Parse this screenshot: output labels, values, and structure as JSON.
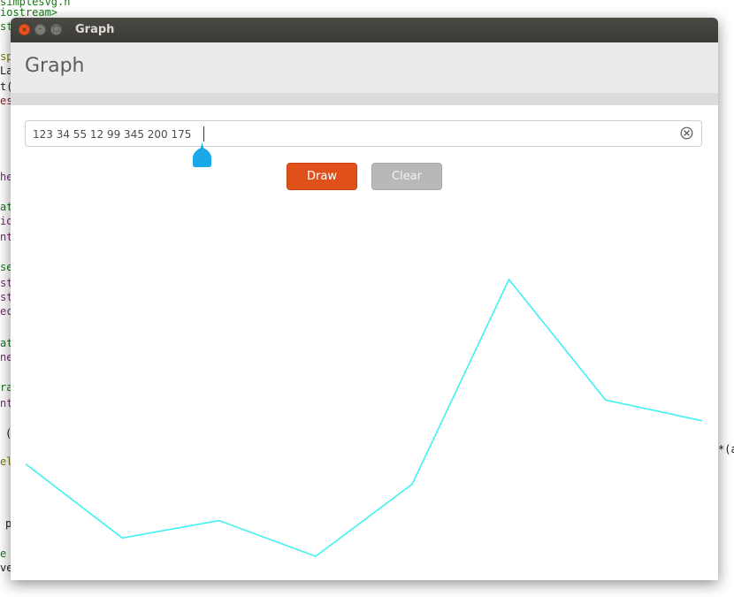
{
  "background": {
    "code_lines": [
      {
        "text": "simplesvg.h",
        "class": "green"
      },
      {
        "text": "iostream>",
        "class": "green"
      },
      {
        "text": "st",
        "class": "green"
      },
      {
        "text": "sp",
        "class": "olive"
      },
      {
        "text": "La",
        "class": ""
      },
      {
        "text": "t(",
        "class": ""
      },
      {
        "text": "es",
        "class": "red"
      },
      {
        "text": "he",
        "class": "purple"
      },
      {
        "text": "at",
        "class": "green"
      },
      {
        "text": "io",
        "class": "purple"
      },
      {
        "text": "nt",
        "class": "purple"
      },
      {
        "text": "se",
        "class": "green"
      },
      {
        "text": "st",
        "class": "purple"
      },
      {
        "text": "st",
        "class": "purple"
      },
      {
        "text": "ec",
        "class": "purple"
      },
      {
        "text": "at",
        "class": "green"
      },
      {
        "text": "ne",
        "class": "purple"
      },
      {
        "text": "ra",
        "class": "green"
      },
      {
        "text": "nt",
        "class": "purple"
      },
      {
        "text": "(",
        "class": ""
      },
      {
        "text": "el",
        "class": "olive"
      },
      {
        "text": "p",
        "class": ""
      },
      {
        "text": "e",
        "class": "green"
      },
      {
        "text": "ve",
        "class": ""
      }
    ],
    "right_code": "*(a"
  },
  "window": {
    "title": "Graph",
    "controls": {
      "close": "×",
      "minimize": "–",
      "maximize": "□"
    }
  },
  "header": {
    "title": "Graph"
  },
  "entry": {
    "value": "123 34 55 12 99 345 200 175",
    "clear_icon": "clear-circle-icon"
  },
  "buttons": {
    "draw_label": "Draw",
    "clear_label": "Clear"
  },
  "colors": {
    "accent": "#e0501a",
    "line": "#3ff2f2",
    "handle": "#19a8e8"
  },
  "chart_data": {
    "type": "line",
    "values": [
      123,
      34,
      55,
      12,
      99,
      345,
      200,
      175
    ],
    "ylim": [
      0,
      345
    ],
    "series": [
      {
        "values": [
          123,
          34,
          55,
          12,
          99,
          345,
          200,
          175
        ]
      }
    ]
  }
}
